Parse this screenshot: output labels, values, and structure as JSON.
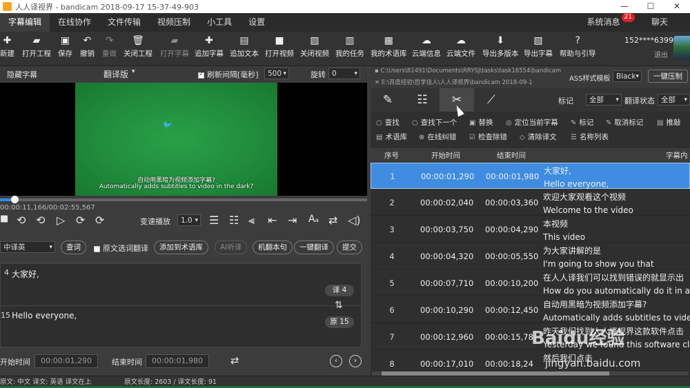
{
  "window": {
    "title": "人人译视界 - bandicam 2018-09-17 15-37-49-903",
    "controls": [
      "—",
      "☐",
      "✕"
    ]
  },
  "menu": {
    "items": [
      "字幕编辑",
      "在线协作",
      "文件传输",
      "视频压制",
      "小工具",
      "设置"
    ],
    "active_index": 0,
    "system_msg": "系统消息",
    "msg_count": "21",
    "chat": "聊天"
  },
  "toolbar": {
    "buttons": [
      {
        "label": "新建",
        "icon": "new-icon",
        "glyph": "✚"
      },
      {
        "label": "打开工程",
        "icon": "open-folder-icon",
        "glyph": "▰"
      },
      {
        "label": "保存",
        "icon": "save-icon",
        "glyph": "▣"
      },
      {
        "label": "撤销",
        "icon": "undo-icon",
        "glyph": "↶"
      },
      {
        "label": "重做",
        "icon": "redo-icon",
        "glyph": "↷"
      },
      {
        "label": "关闭工程",
        "icon": "trash-icon",
        "glyph": "🗑"
      },
      {
        "label": "打开字幕",
        "icon": "open-subtitle-icon",
        "glyph": "▰"
      },
      {
        "label": "追加字幕",
        "icon": "add-icon",
        "glyph": "✚"
      },
      {
        "label": "追加文本",
        "icon": "text-icon",
        "glyph": "▤"
      },
      {
        "label": "打开视频",
        "icon": "video-icon",
        "glyph": "■"
      },
      {
        "label": "关闭视频",
        "icon": "close-video-icon",
        "glyph": "▨"
      },
      {
        "label": "我的任务",
        "icon": "task-icon",
        "glyph": "▥"
      },
      {
        "label": "我的术语库",
        "icon": "glossary-icon",
        "glyph": "▦"
      },
      {
        "label": "云端信息",
        "icon": "cloud-icon",
        "glyph": "☁"
      },
      {
        "label": "云端文件",
        "icon": "cloud-upload-icon",
        "glyph": "☁"
      },
      {
        "label": "导出多版本",
        "icon": "export-multi-icon",
        "glyph": "⬇"
      },
      {
        "label": "导出字幕",
        "icon": "export-icon",
        "glyph": "▧"
      },
      {
        "label": "帮助与引导",
        "icon": "help-icon",
        "glyph": "?"
      }
    ],
    "account": "152****6399",
    "logout": "退出"
  },
  "player": {
    "hide_subtitles": "隐藏字幕",
    "version": "翻译版",
    "refresh_label": "刷新间隔[毫秒]",
    "refresh_value": "500",
    "rotate_label": "旋转",
    "rotate_value": "0",
    "subtitle_cn": "自动用黑暗为视频添加字幕?",
    "subtitle_en": "Automatically adds subtitles to video in the dark?",
    "timecode": "00:00:11,166/00:02:55,567",
    "progress_fraction": 0.04,
    "speed_label": "变速播放",
    "speed_value": "1.0"
  },
  "translate": {
    "lang": "中译英",
    "buttons": [
      "查词",
      "原文选词翻译",
      "添加到术语库",
      "AI听译",
      "机翻本句",
      "一键翻译",
      "提交"
    ],
    "line_top_num": "4",
    "line_top_text": "大家好,",
    "line_bottom_num": "15",
    "line_bottom_text": "Hello everyone,",
    "tag_trans": "译 4",
    "tag_orig": "原 15",
    "start_label": "开始时间",
    "start_value": "00:00:01,290",
    "end_label": "结束时间",
    "end_value": "00:00:01,980"
  },
  "status": {
    "text": "原文: 中文 译文: 英语  译文在上",
    "lengths": "原文长度: 2603 / 译文长度: 91"
  },
  "right": {
    "path1": "C:\\Users\\81491\\Documents\\RRYSJ\\tasks\\task16554\\bandicam",
    "path2": "E:\\百度经验\\哲学佳人\\人人译视界\\bandicam 2018-09-1",
    "ass_label": "ASS样式模板",
    "ass_value": "Black",
    "one_click": "一键压制",
    "mark_label": "标记",
    "mark_value": "全部",
    "state_label": "翻译状态",
    "state_value": "全部",
    "tools_row1": [
      "查找",
      "查找下一个",
      "替换",
      "定位当前字幕",
      "标记",
      "取消标记",
      "推敲"
    ],
    "tools_row2": [
      "术语库",
      "在线纠错",
      "检查除错",
      "清除译文",
      "名称列表"
    ],
    "headers": [
      "序号",
      "开始时间",
      "结束时间",
      "字幕内"
    ],
    "rows": [
      {
        "n": "1",
        "start": "00:00:01,290",
        "end": "00:00:01,980",
        "cn": "大家好,",
        "en": "Hello everyone,"
      },
      {
        "n": "2",
        "start": "00:00:02,040",
        "end": "00:00:03,360",
        "cn": "欢迎大家观看这个视频",
        "en": "Welcome to the video"
      },
      {
        "n": "3",
        "start": "00:00:03,750",
        "end": "00:00:04,290",
        "cn": "本视频",
        "en": "This video"
      },
      {
        "n": "4",
        "start": "00:00:04,320",
        "end": "00:00:05,550",
        "cn": "为大家讲解的是",
        "en": "I'm going to show you that"
      },
      {
        "n": "5",
        "start": "00:00:07,710",
        "end": "00:00:10,200",
        "cn": "在人人译我们可以找到错误的就显示出",
        "en": "How do you automatically do it in a"
      },
      {
        "n": "6",
        "start": "00:00:10,290",
        "end": "00:00:12,450",
        "cn": "自动用黑暗为视频添加字幕?",
        "en": "Automatically adds subtitles to video"
      },
      {
        "n": "7",
        "start": "00:00:12,960",
        "end": "00:00:15,78",
        "cn": "昨天我们找到人人译视界这款软件点击",
        "en": "Yesterday we found this software clicking"
      },
      {
        "n": "8",
        "start": "00:00:17,010",
        "end": "00:00:18,24",
        "cn": "然后我们点击",
        "en": ""
      }
    ]
  },
  "watermark": {
    "brand": "Baidu经验",
    "url": "jingyan.baidu.com"
  }
}
